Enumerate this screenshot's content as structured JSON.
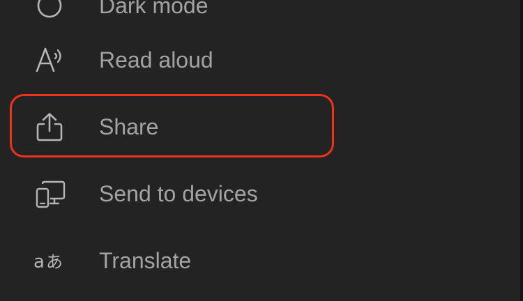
{
  "menu": {
    "items": [
      {
        "id": "dark-mode",
        "label": "Dark mode",
        "icon": "dark-mode-icon"
      },
      {
        "id": "read-aloud",
        "label": "Read aloud",
        "icon": "read-aloud-icon"
      },
      {
        "id": "share",
        "label": "Share",
        "icon": "share-icon",
        "highlighted": true
      },
      {
        "id": "send-to-devices",
        "label": "Send to devices",
        "icon": "send-to-devices-icon"
      },
      {
        "id": "translate",
        "label": "Translate",
        "icon": "translate-icon"
      }
    ]
  },
  "colors": {
    "background": "#232323",
    "text": "#a3a3a3",
    "icon": "#b5b5b5",
    "highlight": "#f0311e"
  }
}
